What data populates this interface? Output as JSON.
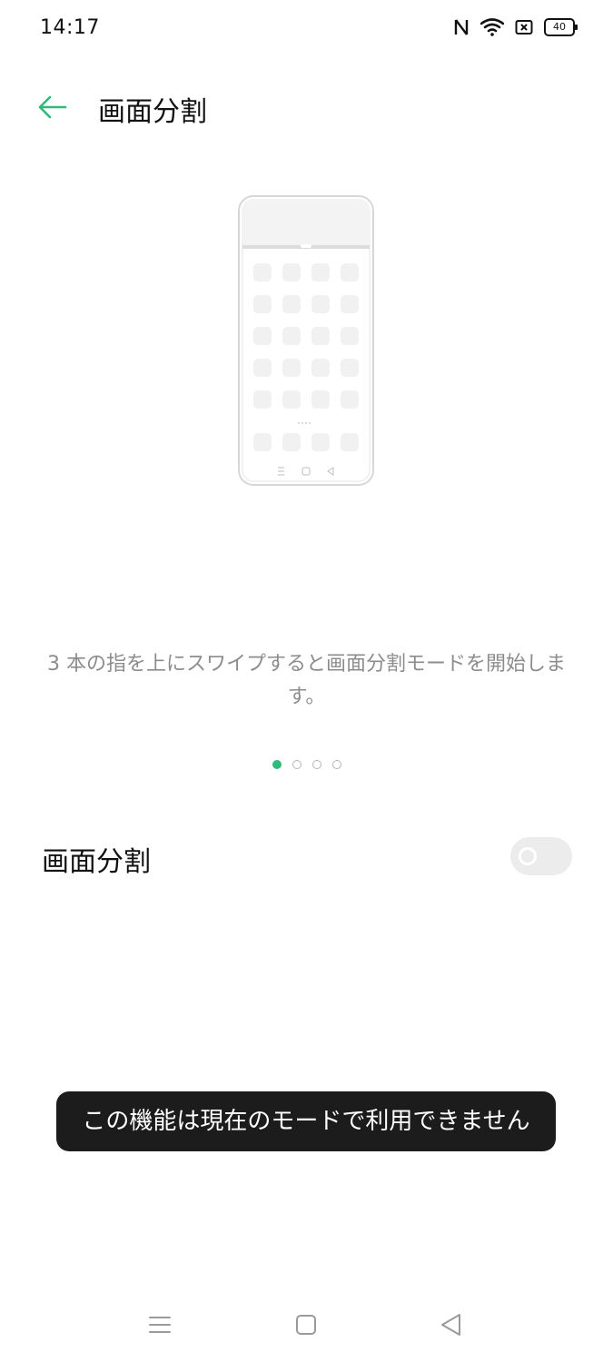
{
  "status_bar": {
    "time": "14:17",
    "battery": "40",
    "icons": [
      "nfc-icon",
      "wifi-icon",
      "no-sim-icon",
      "battery-icon"
    ]
  },
  "header": {
    "title": "画面分割",
    "back_icon": "arrow-left-icon"
  },
  "illustration": {
    "icon": "phone-split-screen-illustration"
  },
  "description": "3 本の指を上にスワイプすると画面分割モードを開始します。",
  "pager": {
    "count": 4,
    "active_index": 0
  },
  "setting": {
    "label": "画面分割",
    "enabled": false
  },
  "toast": {
    "message": "この機能は現在のモードで利用できません"
  },
  "nav_bar": {
    "items": [
      "menu-icon",
      "home-icon",
      "back-triangle-icon"
    ]
  },
  "colors": {
    "accent": "#2fb97a",
    "toast_bg": "#1c1c1c",
    "description": "#8c8c8c",
    "toggle_off": "#ececec"
  }
}
